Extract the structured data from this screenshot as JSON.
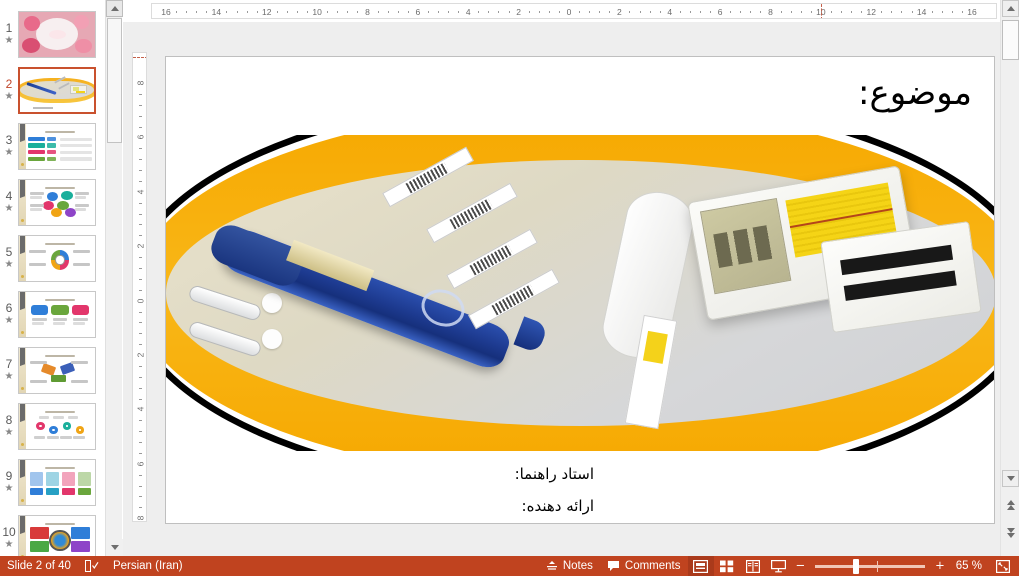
{
  "app": {
    "name": "PowerPoint",
    "accent_color": "#c0431f",
    "selection_color": "#c9512e"
  },
  "thumbnail_pane": {
    "scroll_up_icon": "triangle-up-icon",
    "scroll_down_icon": "triangle-down-icon",
    "animation_marker_icon": "star-icon",
    "selected_index": 2,
    "slides": [
      {
        "number": "1",
        "animated": true,
        "theme": "pink-floral-title"
      },
      {
        "number": "2",
        "animated": true,
        "theme": "insulin-pen-glucose-meter"
      },
      {
        "number": "3",
        "animated": true,
        "theme": "table-and-color-bars"
      },
      {
        "number": "4",
        "animated": true,
        "theme": "hexagon-cluster-diagram"
      },
      {
        "number": "5",
        "animated": true,
        "theme": "circular-segment-diagram"
      },
      {
        "number": "6",
        "animated": true,
        "theme": "three-speech-bubbles"
      },
      {
        "number": "7",
        "animated": true,
        "theme": "arrow-convergence-diagram"
      },
      {
        "number": "8",
        "animated": true,
        "theme": "connected-circles-timeline"
      },
      {
        "number": "9",
        "animated": true,
        "theme": "four-card-grid"
      },
      {
        "number": "10",
        "animated": true,
        "theme": "color-wheel-globe"
      }
    ]
  },
  "ruler": {
    "horizontal_labels": [
      "16",
      "14",
      "12",
      "10",
      "8",
      "6",
      "4",
      "2",
      "0",
      "2",
      "4",
      "6",
      "8",
      "10",
      "12",
      "14",
      "16"
    ],
    "vertical_labels": [
      "8",
      "6",
      "4",
      "2",
      "0",
      "2",
      "4",
      "6",
      "8"
    ],
    "unit": "cm"
  },
  "slide": {
    "title": "موضوع:",
    "lines": [
      "استاد راهنما:",
      "ارائه دهنده:"
    ],
    "image_alt": "insulin pen, lancets, test strips and blood glucose meter",
    "band_color": "#f6a800",
    "outline_color": "#000000"
  },
  "status_bar": {
    "slide_counter": "Slide 2 of 40",
    "proofing_icon": "spell-check-icon",
    "language": "Persian (Iran)",
    "notes_icon": "notes-icon",
    "notes_label": "Notes",
    "comments_icon": "comment-icon",
    "comments_label": "Comments",
    "views": [
      {
        "name": "normal-view",
        "icon": "normal-view-icon",
        "active": true
      },
      {
        "name": "slide-sorter-view",
        "icon": "slide-sorter-icon",
        "active": false
      },
      {
        "name": "reading-view",
        "icon": "reading-view-icon",
        "active": false
      },
      {
        "name": "slide-show-view",
        "icon": "slide-show-icon",
        "active": false
      }
    ],
    "zoom_out_label": "−",
    "zoom_in_label": "+",
    "zoom_level": "65 %",
    "fit_button_icon": "fit-to-window-icon"
  },
  "scrollbars": {
    "up_icon": "triangle-up-icon",
    "down_icon": "triangle-down-icon",
    "prev_slide_icon": "double-up-icon",
    "next_slide_icon": "double-down-icon"
  }
}
